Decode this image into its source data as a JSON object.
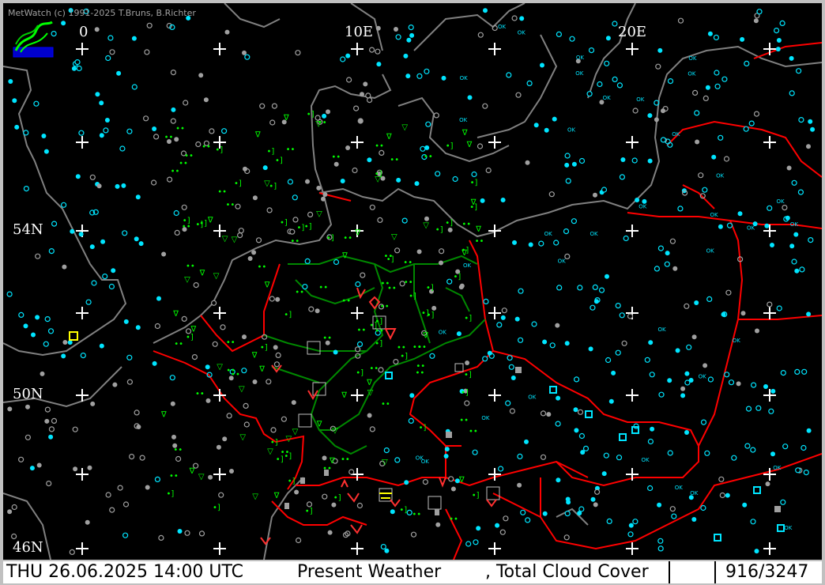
{
  "app": {
    "credit": "MetWatch  (c) 1991-2025 T.Bruns, B.Richter"
  },
  "map": {
    "longitude_labels": [
      "0",
      "10E",
      "20E"
    ],
    "latitude_labels": [
      "54N",
      "50N",
      "46N"
    ],
    "colors": {
      "background": "#000000",
      "coastline": "#808080",
      "border": "#ff0000",
      "inner_border": "#00aa00",
      "grid": "#ffffff",
      "station_cloud": "#00e5ff",
      "station_grey": "#a0a0a0",
      "weather": "#00ff00",
      "warning": "#ff3030"
    }
  },
  "status": {
    "datetime": "THU 26.06.2025 14:00 UTC",
    "product": "Present Weather",
    "overlay": ", Total Cloud Cover",
    "count": "916/3247"
  }
}
